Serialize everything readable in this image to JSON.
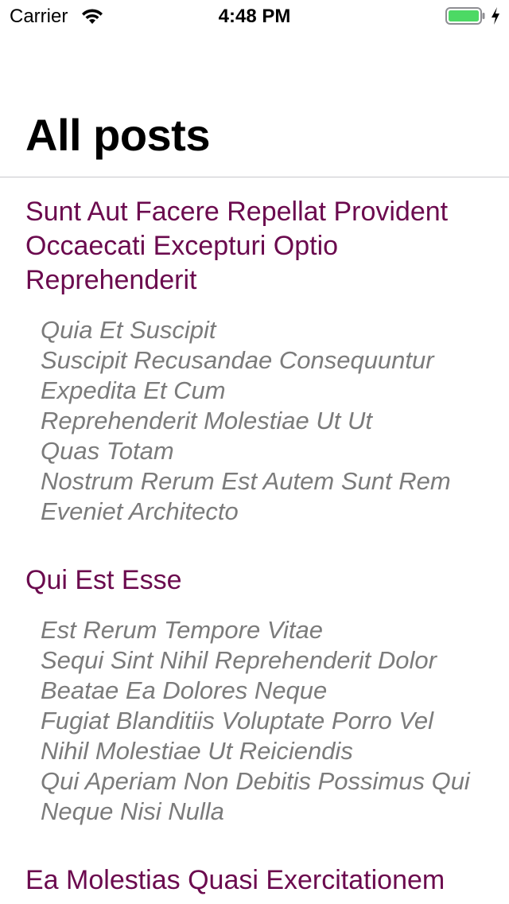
{
  "status_bar": {
    "carrier": "Carrier",
    "time": "4:48 PM",
    "battery_color": "#4cd964"
  },
  "header": {
    "title": "All posts"
  },
  "posts": [
    {
      "title": "Sunt Aut Facere Repellat Provident Occaecati Excepturi Optio Reprehenderit",
      "body": "Quia Et Suscipit\nSuscipit Recusandae Consequuntur\nExpedita Et Cum\nReprehenderit Molestiae Ut Ut\nQuas Totam\nNostrum Rerum Est Autem Sunt Rem\nEveniet Architecto"
    },
    {
      "title": "Qui Est Esse",
      "body": "Est Rerum Tempore Vitae\nSequi Sint Nihil Reprehenderit Dolor\nBeatae Ea Dolores Neque\nFugiat Blanditiis Voluptate Porro Vel\nNihil Molestiae Ut Reiciendis\nQui Aperiam Non Debitis Possimus Qui\nNeque Nisi Nulla"
    },
    {
      "title": "Ea Molestias Quasi Exercitationem",
      "body": ""
    }
  ],
  "colors": {
    "post_title": "#6b0a4e",
    "post_body": "#7b7b7b"
  }
}
